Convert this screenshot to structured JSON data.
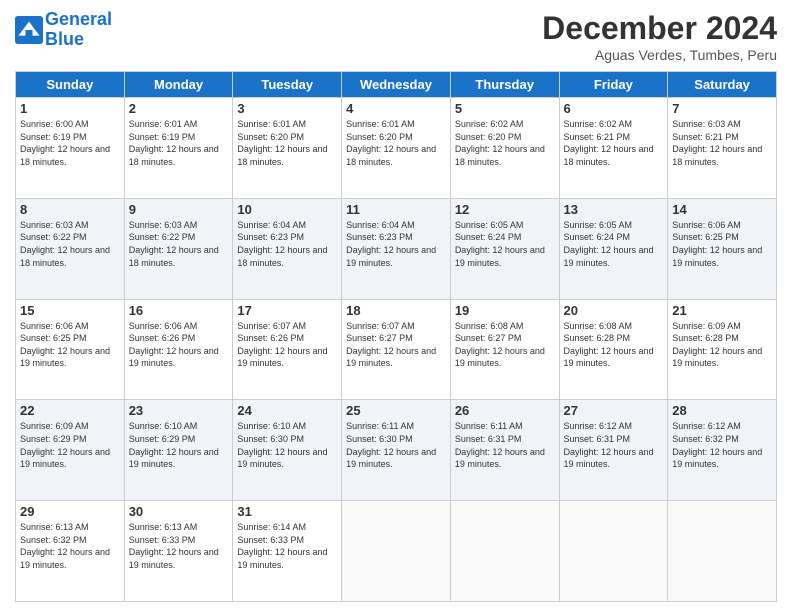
{
  "logo": {
    "line1": "General",
    "line2": "Blue"
  },
  "title": "December 2024",
  "subtitle": "Aguas Verdes, Tumbes, Peru",
  "days_of_week": [
    "Sunday",
    "Monday",
    "Tuesday",
    "Wednesday",
    "Thursday",
    "Friday",
    "Saturday"
  ],
  "weeks": [
    [
      {
        "day": "1",
        "rise": "6:00 AM",
        "set": "6:19 PM",
        "daylight": "12 hours and 18 minutes."
      },
      {
        "day": "2",
        "rise": "6:01 AM",
        "set": "6:19 PM",
        "daylight": "12 hours and 18 minutes."
      },
      {
        "day": "3",
        "rise": "6:01 AM",
        "set": "6:20 PM",
        "daylight": "12 hours and 18 minutes."
      },
      {
        "day": "4",
        "rise": "6:01 AM",
        "set": "6:20 PM",
        "daylight": "12 hours and 18 minutes."
      },
      {
        "day": "5",
        "rise": "6:02 AM",
        "set": "6:20 PM",
        "daylight": "12 hours and 18 minutes."
      },
      {
        "day": "6",
        "rise": "6:02 AM",
        "set": "6:21 PM",
        "daylight": "12 hours and 18 minutes."
      },
      {
        "day": "7",
        "rise": "6:03 AM",
        "set": "6:21 PM",
        "daylight": "12 hours and 18 minutes."
      }
    ],
    [
      {
        "day": "8",
        "rise": "6:03 AM",
        "set": "6:22 PM",
        "daylight": "12 hours and 18 minutes."
      },
      {
        "day": "9",
        "rise": "6:03 AM",
        "set": "6:22 PM",
        "daylight": "12 hours and 18 minutes."
      },
      {
        "day": "10",
        "rise": "6:04 AM",
        "set": "6:23 PM",
        "daylight": "12 hours and 18 minutes."
      },
      {
        "day": "11",
        "rise": "6:04 AM",
        "set": "6:23 PM",
        "daylight": "12 hours and 19 minutes."
      },
      {
        "day": "12",
        "rise": "6:05 AM",
        "set": "6:24 PM",
        "daylight": "12 hours and 19 minutes."
      },
      {
        "day": "13",
        "rise": "6:05 AM",
        "set": "6:24 PM",
        "daylight": "12 hours and 19 minutes."
      },
      {
        "day": "14",
        "rise": "6:06 AM",
        "set": "6:25 PM",
        "daylight": "12 hours and 19 minutes."
      }
    ],
    [
      {
        "day": "15",
        "rise": "6:06 AM",
        "set": "6:25 PM",
        "daylight": "12 hours and 19 minutes."
      },
      {
        "day": "16",
        "rise": "6:06 AM",
        "set": "6:26 PM",
        "daylight": "12 hours and 19 minutes."
      },
      {
        "day": "17",
        "rise": "6:07 AM",
        "set": "6:26 PM",
        "daylight": "12 hours and 19 minutes."
      },
      {
        "day": "18",
        "rise": "6:07 AM",
        "set": "6:27 PM",
        "daylight": "12 hours and 19 minutes."
      },
      {
        "day": "19",
        "rise": "6:08 AM",
        "set": "6:27 PM",
        "daylight": "12 hours and 19 minutes."
      },
      {
        "day": "20",
        "rise": "6:08 AM",
        "set": "6:28 PM",
        "daylight": "12 hours and 19 minutes."
      },
      {
        "day": "21",
        "rise": "6:09 AM",
        "set": "6:28 PM",
        "daylight": "12 hours and 19 minutes."
      }
    ],
    [
      {
        "day": "22",
        "rise": "6:09 AM",
        "set": "6:29 PM",
        "daylight": "12 hours and 19 minutes."
      },
      {
        "day": "23",
        "rise": "6:10 AM",
        "set": "6:29 PM",
        "daylight": "12 hours and 19 minutes."
      },
      {
        "day": "24",
        "rise": "6:10 AM",
        "set": "6:30 PM",
        "daylight": "12 hours and 19 minutes."
      },
      {
        "day": "25",
        "rise": "6:11 AM",
        "set": "6:30 PM",
        "daylight": "12 hours and 19 minutes."
      },
      {
        "day": "26",
        "rise": "6:11 AM",
        "set": "6:31 PM",
        "daylight": "12 hours and 19 minutes."
      },
      {
        "day": "27",
        "rise": "6:12 AM",
        "set": "6:31 PM",
        "daylight": "12 hours and 19 minutes."
      },
      {
        "day": "28",
        "rise": "6:12 AM",
        "set": "6:32 PM",
        "daylight": "12 hours and 19 minutes."
      }
    ],
    [
      {
        "day": "29",
        "rise": "6:13 AM",
        "set": "6:32 PM",
        "daylight": "12 hours and 19 minutes."
      },
      {
        "day": "30",
        "rise": "6:13 AM",
        "set": "6:33 PM",
        "daylight": "12 hours and 19 minutes."
      },
      {
        "day": "31",
        "rise": "6:14 AM",
        "set": "6:33 PM",
        "daylight": "12 hours and 19 minutes."
      },
      null,
      null,
      null,
      null
    ]
  ]
}
